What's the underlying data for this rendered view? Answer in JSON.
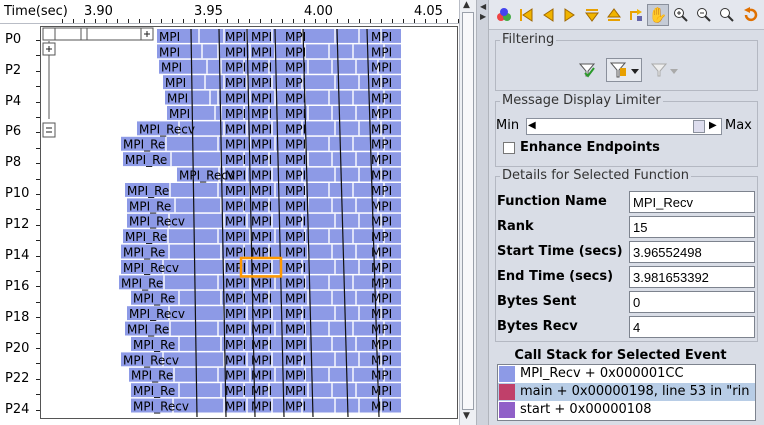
{
  "timeline": {
    "axis_title": "Time(sec)",
    "time_labels": [
      "3.90",
      "3.95",
      "4.00",
      "4.05"
    ],
    "rank_labels": [
      "P0",
      "P2",
      "P4",
      "P6",
      "P8",
      "P10",
      "P12",
      "P14",
      "P16",
      "P18",
      "P20",
      "P22",
      "P24"
    ],
    "event_label_short": "MPI",
    "event_label_mid": "MPI_Re",
    "event_label_recv": "MPI_Recv",
    "event_color": "#8d9ae6",
    "highlight_color": "#ff9900"
  },
  "toolbar": {
    "icons": [
      "color-wheel-icon",
      "first-icon",
      "prev-icon",
      "next-icon",
      "last-icon",
      "down-icon",
      "up-icon",
      "jump-icon",
      "hand-icon",
      "zoom-in-icon",
      "zoom-out-icon",
      "zoom-fit-icon",
      "undo-icon"
    ]
  },
  "filtering": {
    "title": "Filtering"
  },
  "limiter": {
    "title": "Message Display Limiter",
    "min_label": "Min",
    "max_label": "Max",
    "enhance_label": "Enhance Endpoints"
  },
  "details": {
    "title": "Details for Selected Function",
    "fields": [
      {
        "label": "Function Name",
        "value": "MPI_Recv"
      },
      {
        "label": "Rank",
        "value": "15"
      },
      {
        "label": "Start Time (secs)",
        "value": "3.96552498"
      },
      {
        "label": "End Time (secs)",
        "value": "3.981653392"
      },
      {
        "label": "Bytes Sent",
        "value": "0"
      },
      {
        "label": "Bytes Recv",
        "value": "4"
      }
    ]
  },
  "callstack": {
    "title": "Call Stack for Selected Event",
    "rows": [
      {
        "text": "MPI_Recv + 0x000001CC",
        "color": "#8d9ae6"
      },
      {
        "text": "main + 0x00000198, line 53 in \"rin",
        "color": "#c0406a"
      },
      {
        "text": "start + 0x00000108",
        "color": "#9060c8"
      }
    ]
  }
}
